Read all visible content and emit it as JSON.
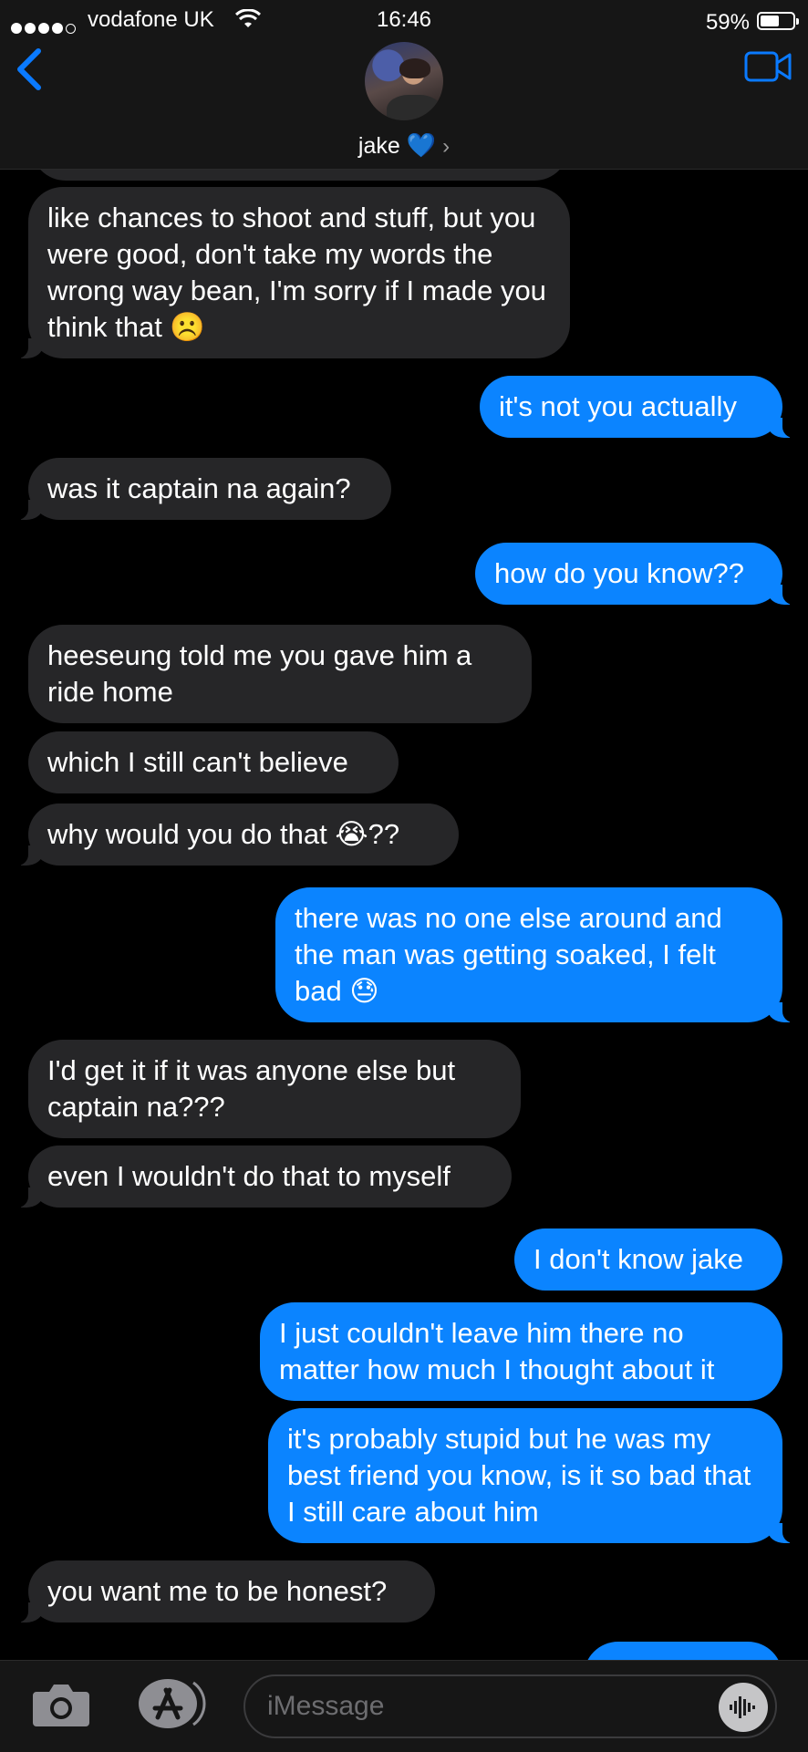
{
  "status_bar": {
    "carrier": "vodafone UK",
    "time": "16:46",
    "battery_percent": "59%",
    "battery_level": 0.59
  },
  "header": {
    "contact_name": "jake",
    "contact_emoji": "💙",
    "icons": [
      "back-chevron-icon",
      "facetime-video-icon",
      "contact-avatar",
      "chevron-right-icon"
    ]
  },
  "messages": [
    {
      "from": "them",
      "text": "like chances to shoot and stuff, but you were good, don't take my words the wrong way bean, I'm sorry if I made you think that ☹️"
    },
    {
      "from": "me",
      "text": "it's not you actually"
    },
    {
      "from": "them",
      "text": "was it captain na again?"
    },
    {
      "from": "me",
      "text": "how do you know??"
    },
    {
      "from": "them",
      "text": "heeseung told me you gave him a ride home"
    },
    {
      "from": "them",
      "text": "which I still can't believe"
    },
    {
      "from": "them",
      "text": "why would you do that 😭??"
    },
    {
      "from": "me",
      "text": "there was no one else around and the man was getting soaked, I felt bad 😓"
    },
    {
      "from": "them",
      "text": "I'd get it if it was anyone else but captain na???"
    },
    {
      "from": "them",
      "text": "even I wouldn't do that to myself"
    },
    {
      "from": "me",
      "text": "I don't know jake"
    },
    {
      "from": "me",
      "text": "I just couldn't leave him there no matter how much I thought about it"
    },
    {
      "from": "me",
      "text": "it's probably stupid but he was my best friend you know, is it so bad that I still care about him"
    },
    {
      "from": "them",
      "text": "you want me to be honest?"
    }
  ],
  "input_bar": {
    "placeholder": "iMessage",
    "icons": [
      "camera-icon",
      "app-store-icon",
      "audio-waveform-icon"
    ]
  },
  "colors": {
    "background": "#000000",
    "incoming_bubble": "#262628",
    "outgoing_bubble": "#0b84ff",
    "accent": "#0a7aff"
  }
}
